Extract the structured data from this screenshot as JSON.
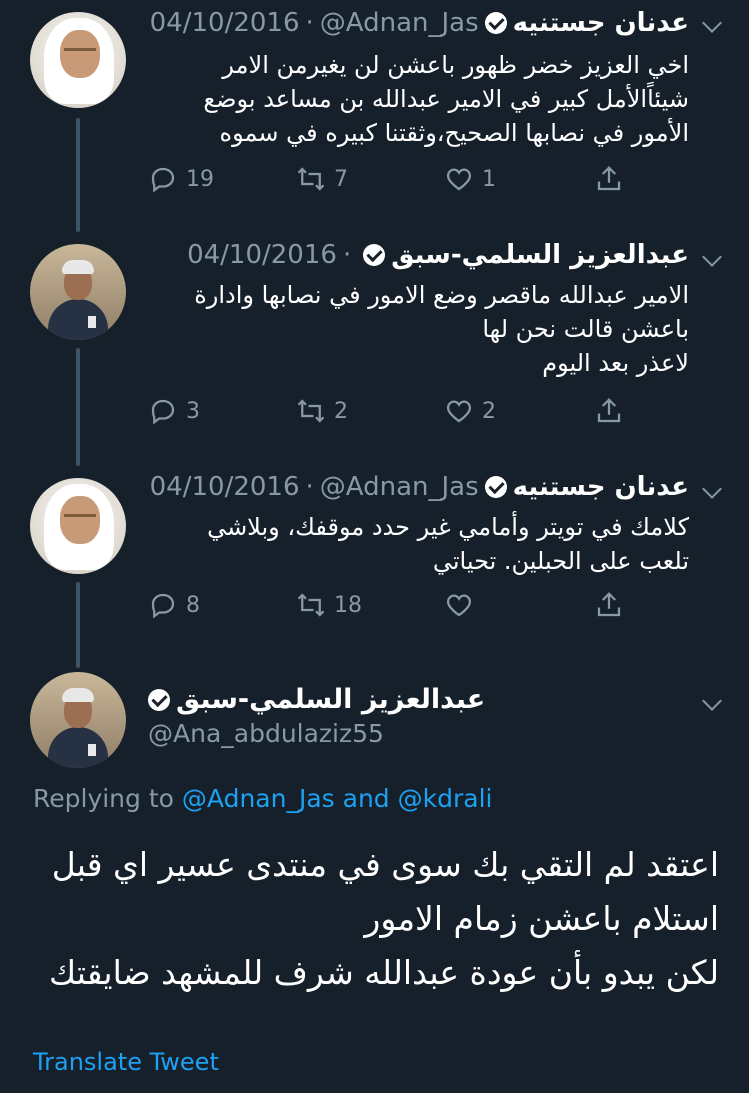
{
  "thread": [
    {
      "author_name": "عدنان جستنيه",
      "handle": "@Adnan_Jas",
      "separator": "·",
      "date": "04/10/2016",
      "text_lines": [
        "اخي العزيز خضر ظهور باعشن لن يغيرمن الامر",
        "شيئاًالأمل كبير في الامير عبدالله بن مساعد بوضع",
        "الأمور في نصابها الصحيح،وثقتنا كبيره في سموه"
      ],
      "replies": "19",
      "retweets": "7",
      "likes": "1"
    },
    {
      "author_name": "عبدالعزيز السلمي-سبق",
      "handle": "",
      "separator": "·",
      "date": "04/10/2016",
      "text_lines": [
        "الامير عبدالله ماقصر وضع الامور في نصابها وادارة",
        "باعشن قالت نحن لها",
        "لاعذر بعد اليوم"
      ],
      "replies": "3",
      "retweets": "2",
      "likes": "2"
    },
    {
      "author_name": "عدنان جستنيه",
      "handle": "@Adnan_Jas",
      "separator": "·",
      "date": "04/10/2016",
      "text_lines": [
        "كلامك في تويتر وأمامي غير حدد موقفك، وبلاشي",
        "تلعب على الحبلين. تحياتي"
      ],
      "replies": "8",
      "retweets": "18",
      "likes": ""
    }
  ],
  "main_tweet": {
    "author_name": "عبدالعزيز السلمي-سبق",
    "handle": "@Ana_abdulaziz55",
    "replying_prefix": "Replying to",
    "replying_to_1": "@Adnan_Jas",
    "replying_and": "and",
    "replying_to_2": "@kdrali",
    "text_lines": [
      "اعتقد لم التقي بك سوى في منتدى عسير اي قبل",
      "استلام باعشن زمام الامور",
      "لكن يبدو بأن عودة عبدالله شرف للمشهد ضايقتك"
    ],
    "translate_label": "Translate Tweet"
  },
  "colors": {
    "background": "#15202b",
    "muted": "#8899a6",
    "link": "#1da1f2",
    "thread_line": "#3d5466"
  },
  "icons": [
    "reply-icon",
    "retweet-icon",
    "like-icon",
    "share-icon",
    "verified-badge-icon",
    "chevron-down-icon"
  ]
}
